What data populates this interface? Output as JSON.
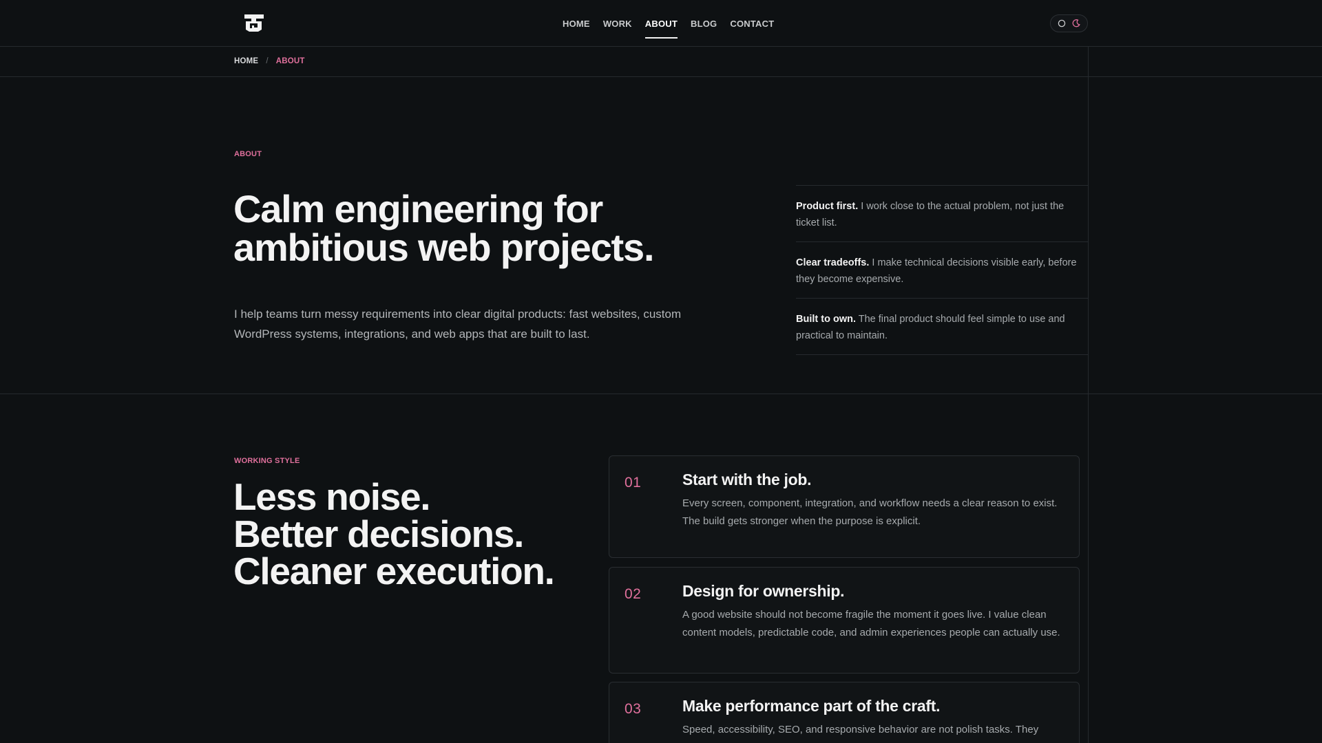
{
  "nav": {
    "items": [
      {
        "label": "HOME",
        "active": false
      },
      {
        "label": "WORK",
        "active": false
      },
      {
        "label": "ABOUT",
        "active": true
      },
      {
        "label": "BLOG",
        "active": false
      },
      {
        "label": "CONTACT",
        "active": false
      }
    ]
  },
  "theme_toggle": {
    "options": [
      "light-icon",
      "dark-icon"
    ],
    "selected": "dark"
  },
  "breadcrumb": {
    "home": "HOME",
    "separator": "/",
    "current": "ABOUT"
  },
  "hero": {
    "eyebrow": "ABOUT",
    "title_line1": "Calm engineering for",
    "title_line2": "ambitious web projects.",
    "description": "I help teams turn messy requirements into clear digital products: fast websites, custom WordPress systems, integrations, and web apps that are built to last."
  },
  "principles": [
    {
      "lead": "Product first.",
      "text": " I work close to the actual problem, not just the ticket list."
    },
    {
      "lead": "Clear tradeoffs.",
      "text": " I make technical decisions visible early, before they become expensive."
    },
    {
      "lead": "Built to own.",
      "text": " The final product should feel simple to use and practical to maintain."
    }
  ],
  "working_style": {
    "eyebrow": "WORKING STYLE",
    "title_line1": "Less noise.",
    "title_line2": "Better decisions.",
    "title_line3": "Cleaner execution.",
    "cards": [
      {
        "num": "01",
        "title": "Start with the job.",
        "body": "Every screen, component, integration, and workflow needs a clear reason to exist. The build gets stronger when the purpose is explicit."
      },
      {
        "num": "02",
        "title": "Design for ownership.",
        "body": "A good website should not become fragile the moment it goes live. I value clean content models, predictable code, and admin experiences people can actually use."
      },
      {
        "num": "03",
        "title": "Make performance part of the craft.",
        "body": "Speed, accessibility, SEO, and responsive behavior are not polish tasks. They"
      }
    ]
  },
  "colors": {
    "accent": "#e0709c",
    "background": "#0e1113",
    "text": "#f3f3f3"
  }
}
